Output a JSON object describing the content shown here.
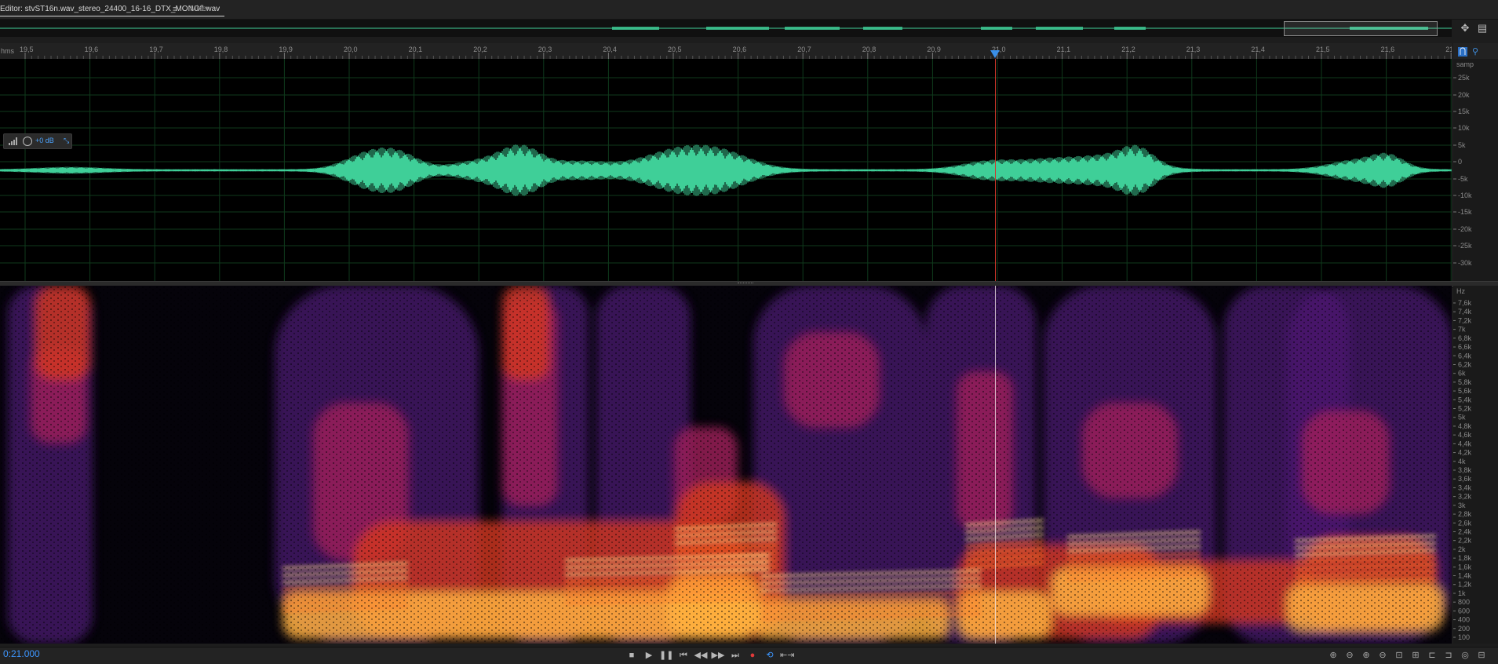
{
  "tabs": {
    "editor_label": "Editor: stvST16n.wav_stereo_24400_16-16_DTX_MONOfl.wav",
    "editor_menu_glyph": "≡",
    "mixer_label": "Mixer"
  },
  "ruler": {
    "unit": "hms",
    "ticks": [
      "19,5",
      "19,6",
      "19,7",
      "19,8",
      "19,9",
      "20,0",
      "20,1",
      "20,2",
      "20,3",
      "20,4",
      "20,5",
      "20,6",
      "20,7",
      "20,8",
      "20,9",
      "21,0",
      "21,1",
      "21,2",
      "21,3",
      "21,4",
      "21,5",
      "21,6",
      "21,"
    ]
  },
  "waveform_scale": {
    "unit": "samp",
    "labels": [
      "25k",
      "20k",
      "15k",
      "10k",
      "5k",
      "0",
      "-5k",
      "-10k",
      "-15k",
      "-20k",
      "-25k",
      "-30k"
    ]
  },
  "spectral_scale": {
    "unit": "Hz",
    "labels": [
      "7,6k",
      "7,4k",
      "7,2k",
      "7k",
      "6,8k",
      "6,6k",
      "6,4k",
      "6,2k",
      "6k",
      "5,8k",
      "5,6k",
      "5,4k",
      "5,2k",
      "5k",
      "4,8k",
      "4,6k",
      "4,4k",
      "4,2k",
      "4k",
      "3,8k",
      "3,6k",
      "3,4k",
      "3,2k",
      "3k",
      "2,8k",
      "2,6k",
      "2,4k",
      "2,2k",
      "2k",
      "1,8k",
      "1,6k",
      "1,4k",
      "1,2k",
      "1k",
      "800",
      "600",
      "400",
      "200",
      "100"
    ]
  },
  "hud": {
    "value": "+0 dB"
  },
  "transport": {
    "time": "0:21.000",
    "buttons": [
      {
        "name": "stop-button",
        "glyph": "■"
      },
      {
        "name": "play-button",
        "glyph": "▶"
      },
      {
        "name": "pause-button",
        "glyph": "❚❚"
      },
      {
        "name": "move-to-previous-button",
        "glyph": "⏮"
      },
      {
        "name": "rewind-button",
        "glyph": "◀◀"
      },
      {
        "name": "fast-forward-button",
        "glyph": "▶▶"
      },
      {
        "name": "move-to-next-button",
        "glyph": "⏭"
      },
      {
        "name": "record-button",
        "glyph": "●"
      },
      {
        "name": "loop-playback-button",
        "glyph": "⟲"
      },
      {
        "name": "skip-selection-button",
        "glyph": "⇤⇥"
      }
    ],
    "zoom_buttons": [
      {
        "name": "zoom-in-amplitude-button",
        "glyph": "⊕"
      },
      {
        "name": "zoom-out-amplitude-button",
        "glyph": "⊖"
      },
      {
        "name": "zoom-in-time-button",
        "glyph": "⊕"
      },
      {
        "name": "zoom-out-time-button",
        "glyph": "⊖"
      },
      {
        "name": "zoom-out-full-button",
        "glyph": "⊡"
      },
      {
        "name": "zoom-in-selection-button",
        "glyph": "⊞"
      },
      {
        "name": "zoom-left-edge-button",
        "glyph": "⊏"
      },
      {
        "name": "zoom-right-edge-button",
        "glyph": "⊐"
      },
      {
        "name": "zoom-to-playhead-button",
        "glyph": "◎"
      },
      {
        "name": "zoom-reset-button",
        "glyph": "⊟"
      }
    ]
  },
  "colors": {
    "waveform": "#3fcf98",
    "playhead": "#d0362b",
    "accent": "#3d96ff"
  }
}
